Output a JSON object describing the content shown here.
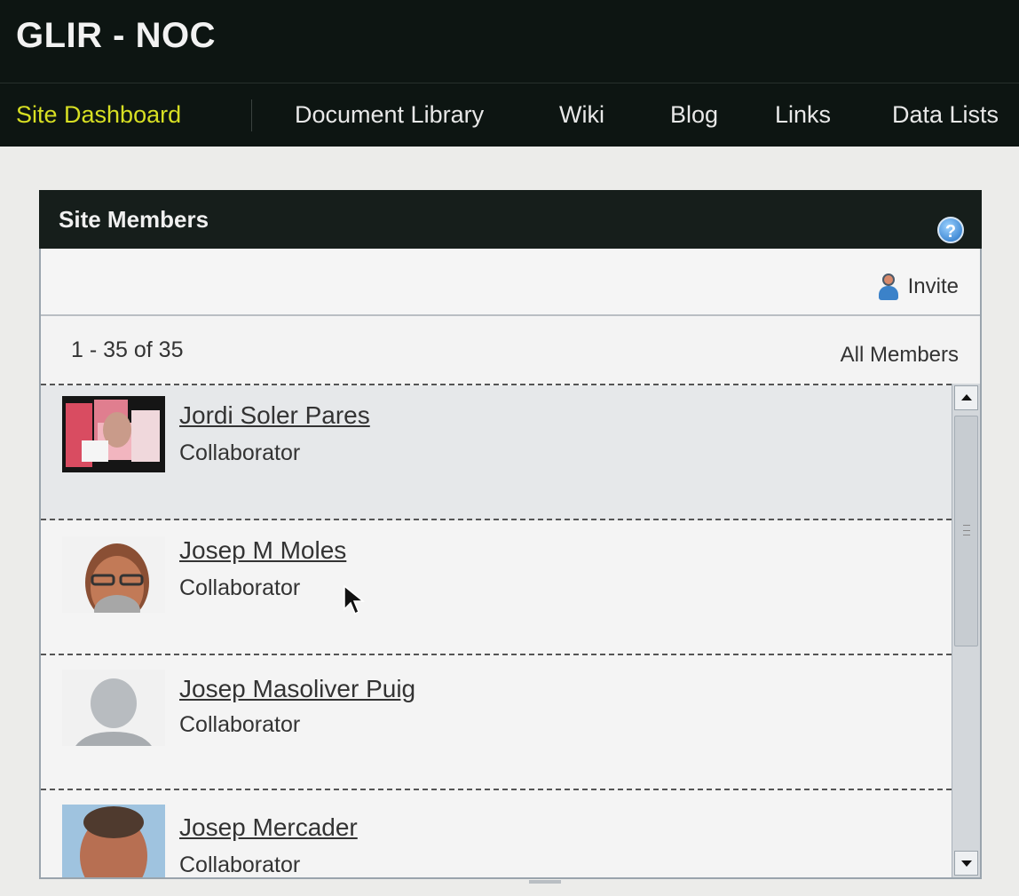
{
  "site": {
    "title": "GLIR - NOC"
  },
  "nav": {
    "items": [
      {
        "label": "Site Dashboard",
        "active": true
      },
      {
        "label": "Document Library"
      },
      {
        "label": "Wiki"
      },
      {
        "label": "Blog"
      },
      {
        "label": "Links"
      },
      {
        "label": "Data Lists"
      }
    ]
  },
  "panel": {
    "title": "Site Members",
    "help_icon": "question-icon",
    "invite_label": "Invite",
    "pager": "1 - 35 of 35",
    "filter_label": "All Members"
  },
  "members": [
    {
      "name": "Jordi Soler Pares",
      "role": "Collaborator"
    },
    {
      "name": "Josep M Moles",
      "role": "Collaborator"
    },
    {
      "name": "Josep Masoliver Puig",
      "role": "Collaborator"
    },
    {
      "name": "Josep Mercader",
      "role": "Collaborator"
    }
  ],
  "colors": {
    "nav_active": "#d7df23",
    "header_bg": "#0d1512",
    "panel_header_bg": "#161e1b"
  }
}
